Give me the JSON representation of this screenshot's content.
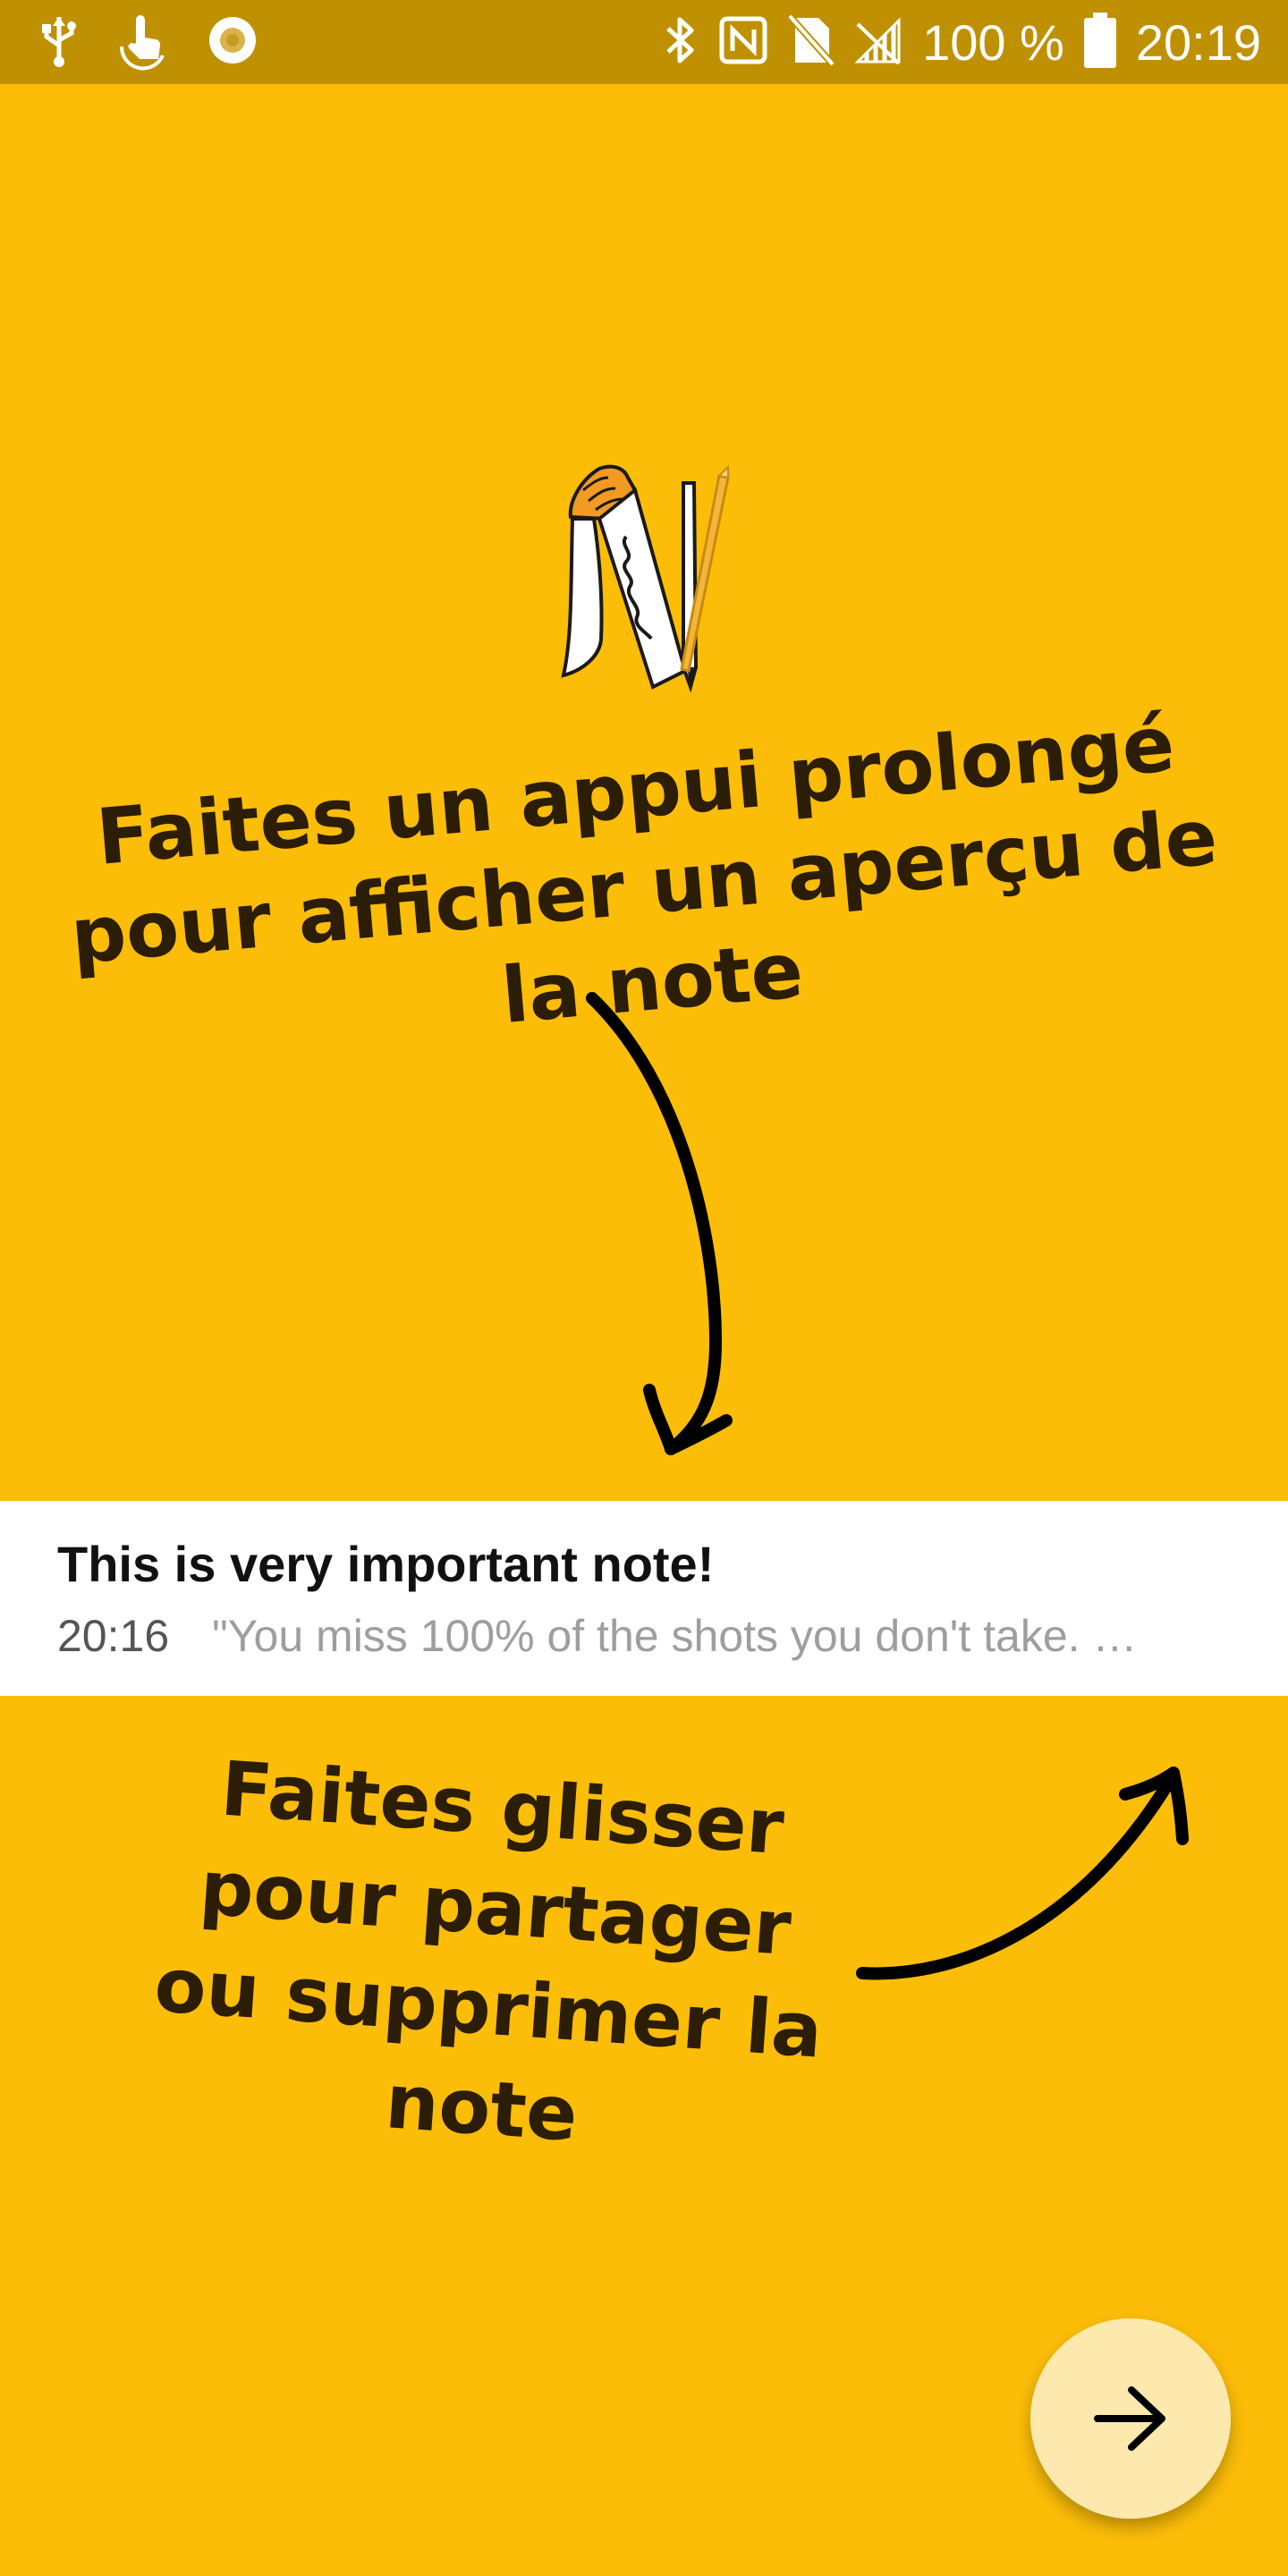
{
  "status_bar": {
    "battery_text": "100 %",
    "time": "20:19",
    "left_icons": [
      "usb-icon",
      "touch-gesture-icon",
      "record-icon"
    ],
    "right_icons": [
      "bluetooth-icon",
      "nfc-icon",
      "no-sim-icon",
      "signal-icon",
      "battery-icon"
    ]
  },
  "logo": {
    "icon": "app-logo-icon"
  },
  "tutorial": {
    "long_press_hint": "Faites un appui prolongé pour afficher un aperçu de la note",
    "swipe_hint": "Faites glisser pour partager ou supprimer la note"
  },
  "note": {
    "title": "This is very important note!",
    "time": "20:16",
    "snippet": "\"You miss 100% of the shots you don't take. …"
  },
  "fab": {
    "icon": "arrow-right-icon"
  },
  "colors": {
    "background": "#FCBD08",
    "status_bar": "#BF9102",
    "text": "#2B1D06",
    "fab": "#FDE9AE"
  }
}
